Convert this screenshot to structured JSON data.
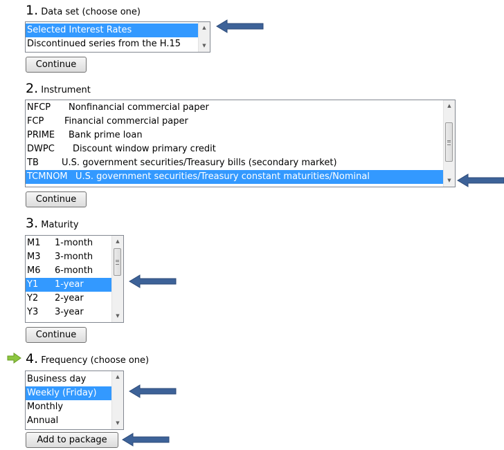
{
  "step1": {
    "number": "1.",
    "title": "Data set (choose one)",
    "items": [
      {
        "label": "Selected Interest Rates",
        "selected": true
      },
      {
        "label": "Discontinued series from the H.15",
        "selected": false
      }
    ],
    "continue_label": "Continue"
  },
  "step2": {
    "number": "2.",
    "title": "Instrument",
    "items": [
      {
        "code": "NFCP",
        "label": "Nonfinancial commercial paper",
        "selected": false
      },
      {
        "code": "FCP",
        "label": "Financial commercial paper",
        "selected": false
      },
      {
        "code": "PRIME",
        "label": "Bank prime loan",
        "selected": false
      },
      {
        "code": "DWPC",
        "label": "Discount window primary credit",
        "selected": false
      },
      {
        "code": "TB",
        "label": "U.S. government securities/Treasury bills (secondary market)",
        "selected": false
      },
      {
        "code": "TCMNOM",
        "label": "U.S. government securities/Treasury constant maturities/Nominal",
        "selected": true
      }
    ],
    "continue_label": "Continue"
  },
  "step3": {
    "number": "3.",
    "title": "Maturity",
    "items": [
      {
        "code": "M1",
        "label": "1-month",
        "selected": false
      },
      {
        "code": "M3",
        "label": "3-month",
        "selected": false
      },
      {
        "code": "M6",
        "label": "6-month",
        "selected": false
      },
      {
        "code": "Y1",
        "label": "1-year",
        "selected": true
      },
      {
        "code": "Y2",
        "label": "2-year",
        "selected": false
      },
      {
        "code": "Y3",
        "label": "3-year",
        "selected": false
      }
    ],
    "continue_label": "Continue"
  },
  "step4": {
    "number": "4.",
    "title": "Frequency (choose one)",
    "items": [
      {
        "label": "Business day",
        "selected": false
      },
      {
        "label": "Weekly (Friday)",
        "selected": true
      },
      {
        "label": "Monthly",
        "selected": false
      },
      {
        "label": "Annual",
        "selected": false
      }
    ],
    "add_label": "Add to package"
  },
  "colors": {
    "selection": "#3399ff",
    "callout_arrow": "#3d6298",
    "step_indicator": "#8cc63f"
  },
  "icons": {
    "current_step": "green-right-arrow-icon",
    "callout": "left-arrow-icon"
  }
}
